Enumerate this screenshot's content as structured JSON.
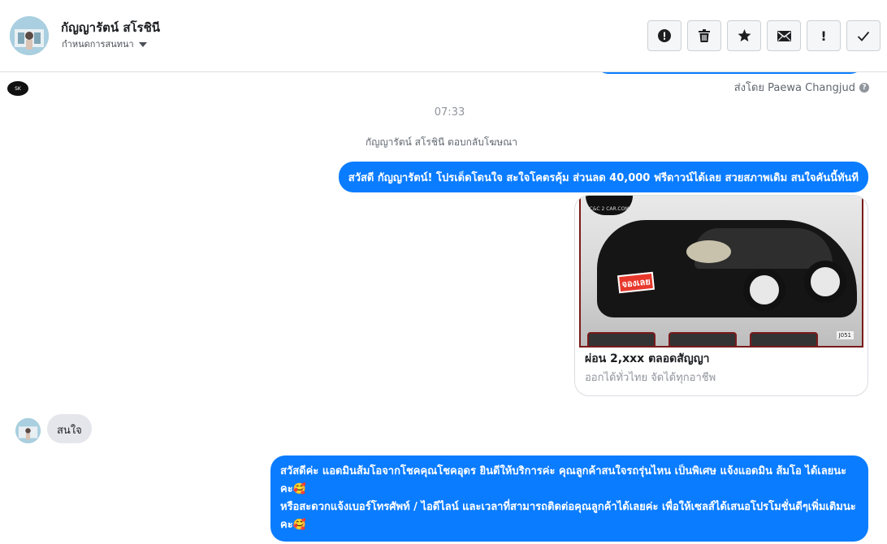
{
  "header": {
    "contact_name": "กัญญารัตน์ สโรชินี",
    "conversation_setting": "กำหนดการสนทนา",
    "actions": [
      {
        "name": "spam-button",
        "icon": "alert-circle-icon"
      },
      {
        "name": "delete-button",
        "icon": "trash-icon"
      },
      {
        "name": "star-button",
        "icon": "star-icon"
      },
      {
        "name": "mark-unread-button",
        "icon": "envelope-icon"
      },
      {
        "name": "follow-up-button",
        "icon": "exclamation-icon",
        "glyph": "!"
      },
      {
        "name": "done-button",
        "icon": "check-icon"
      }
    ]
  },
  "thread": {
    "sent_by": "ส่งโดย Paewa Changjud",
    "timestamp": "07:33",
    "ad_reply_notice": "กัญญารัตน์ สโรชินี ตอบกลับโฆษณา",
    "page_logo_text": "SK",
    "messages": {
      "page_greeting": "สวัสดี กัญญารัตน์! โปรเด็ดโดนใจ สะใจโคตรคุ้ม ส่วนลด 40,000 ฟรีดาวน์ได้เลย สวยสภาพเดิม สนใจคันนี้ทันที",
      "customer_reply": "สนใจ",
      "admin_line1": "สวัสดีค่ะ แอดมินส้มโอจากโชคคุณโชคอุดร ยินดีให้บริการค่ะ   คุณลูกค้าสนใจรถรุ่นไหน เป็นพิเศษ แจ้งแอดมิน ส้มโอ ได้เลยนะคะ🥰",
      "admin_line2": "หรือสะดวกแจ้งเบอร์โทรศัพท์ / ไอดีไลน์ และเวลาที่สามารถติดต่อคุณลูกค้าได้เลยค่ะ เพื่อให้เซลส์ได้เสนอโปรโมชั่นดีๆเพิ่มเติมนะคะ🥰"
    },
    "ad_card": {
      "title": "ผ่อน 2,xxx ตลอดสัญญา",
      "subtitle": "ออกได้ทั่วไทย จัดได้ทุกอาชีพ",
      "stamp_text": "จองเลย",
      "logo_text": "C&C 2 CAR.COM",
      "plate_text": "J051"
    }
  }
}
